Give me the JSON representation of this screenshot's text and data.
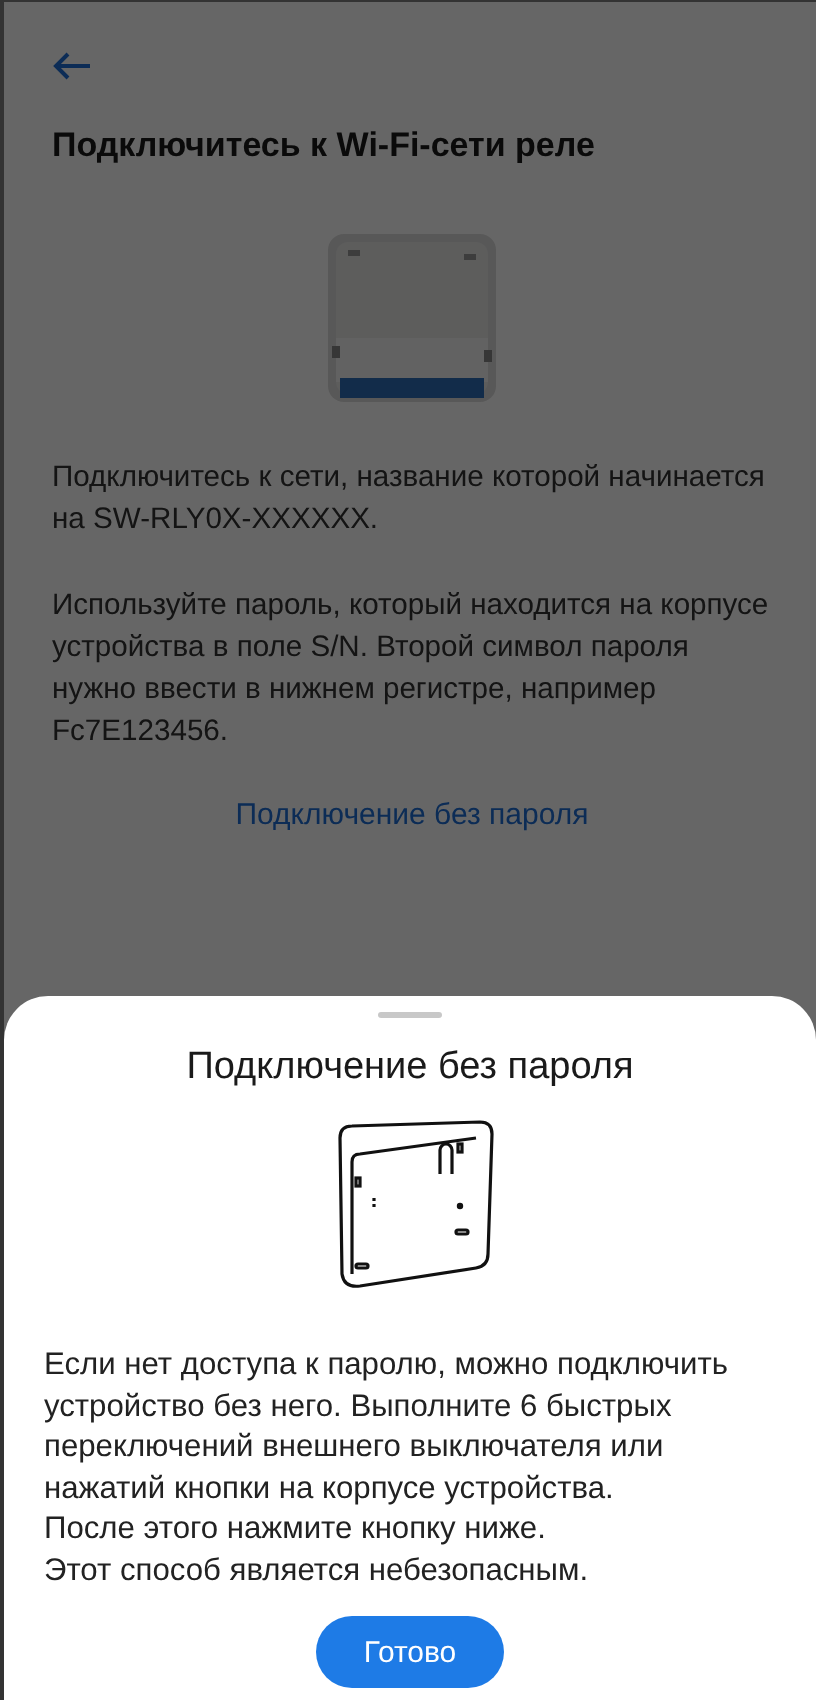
{
  "screen": {
    "title": "Подключитесь к Wi-Fi-сети реле",
    "paragraphs": [
      "Подключитесь к сети, название которой начинается на SW-RLY0X-XXXXXX.",
      "Используйте пароль, который находится на корпусе устройства в поле S/N. Второй символ пароля нужно ввести в нижнем регистре, например Fc7E123456."
    ],
    "link": "Подключение без пароля"
  },
  "sheet": {
    "title": "Подключение без пароля",
    "text": "Если нет доступа к паролю, можно подключить устройство без него. Выполните 6 быстрых переключений внешнего выключателя или нажатий кнопки на корпусе устройства.\nПосле этого нажмите кнопку ниже.\nЭтот способ является небезопасным.",
    "button": "Готово"
  }
}
